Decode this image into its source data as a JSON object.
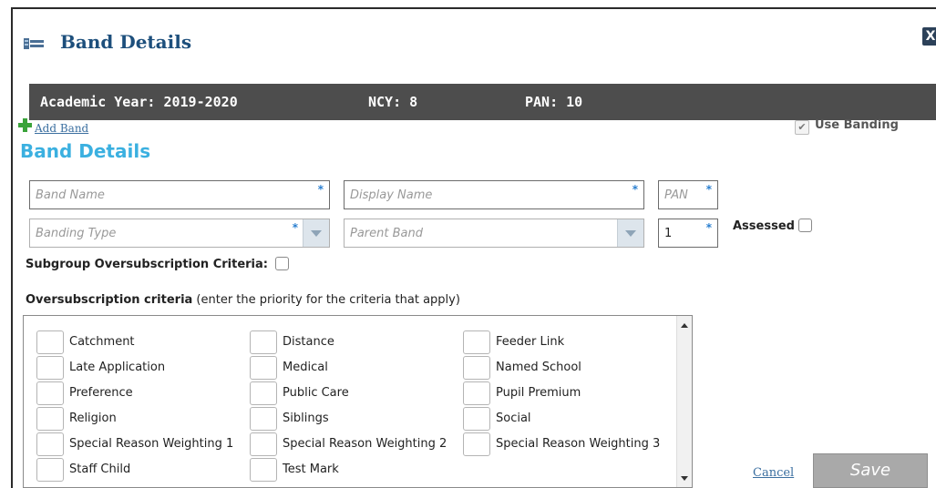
{
  "dialog": {
    "title": "Band Details",
    "close_label": "X"
  },
  "info_bar": {
    "academic_year": "Academic Year: 2019-2020",
    "ncy": "NCY: 8",
    "pan": "PAN: 10"
  },
  "toolbar": {
    "add_band_label": "Add Band",
    "use_banding_label": "Use Banding",
    "use_banding_checked": true
  },
  "section_title": "Band Details",
  "fields": {
    "band_name": {
      "placeholder": "Band Name",
      "required_mark": "*"
    },
    "display_name": {
      "placeholder": "Display Name",
      "required_mark": "*"
    },
    "pan": {
      "placeholder": "PAN",
      "required_mark": "*"
    },
    "banding_type": {
      "placeholder": "Banding Type",
      "required_mark": "*"
    },
    "parent_band": {
      "placeholder": "Parent Band"
    },
    "priority": {
      "value": "1",
      "required_mark": "*"
    }
  },
  "assessed_label": "Assessed",
  "subgroup_label": "Subgroup Oversubscription Criteria:",
  "oversubscription": {
    "label_bold": "Oversubscription criteria",
    "label_rest": " (enter the priority for the criteria that apply)",
    "columns": [
      [
        "Catchment",
        "Late Application",
        "Preference",
        "Religion",
        "Special Reason Weighting 1",
        "Staff Child"
      ],
      [
        "Distance",
        "Medical",
        "Public Care",
        "Siblings",
        "Special Reason Weighting 2",
        "Test Mark"
      ],
      [
        "Feeder Link",
        "Named School",
        "Pupil Premium",
        "Social",
        "Special Reason Weighting 3"
      ]
    ]
  },
  "actions": {
    "cancel_label": "Cancel",
    "save_label": "Save"
  },
  "colors": {
    "title": "#1d4f7c",
    "section_title": "#3bb0e0",
    "info_bar_bg": "#4d4d4d",
    "save_bg": "#a9a9a9"
  }
}
